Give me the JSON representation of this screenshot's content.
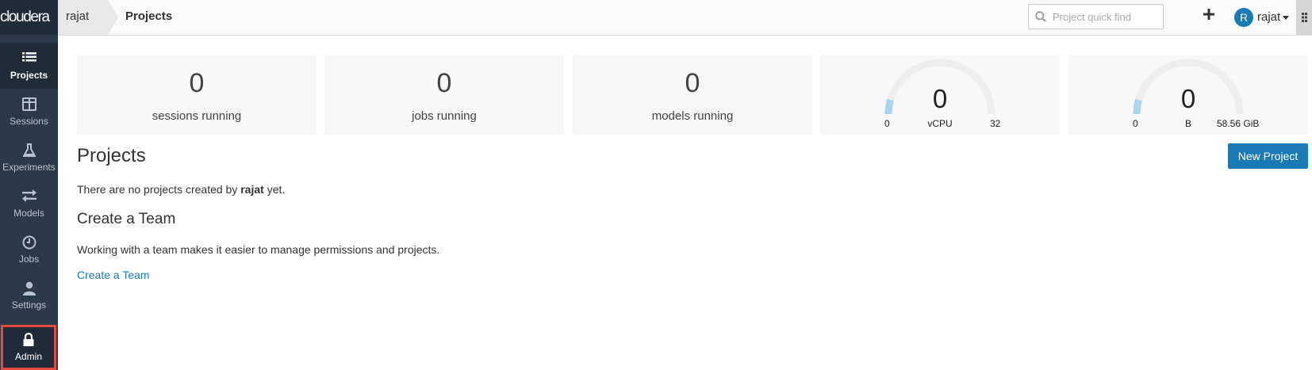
{
  "brand": {
    "logo_text": "cloudera"
  },
  "sidebar": {
    "items": [
      {
        "label": "Projects",
        "icon": "list-icon",
        "active": true
      },
      {
        "label": "Sessions",
        "icon": "columns-icon"
      },
      {
        "label": "Experiments",
        "icon": "flask-icon"
      },
      {
        "label": "Models",
        "icon": "arrows-exchange-icon"
      },
      {
        "label": "Jobs",
        "icon": "clock-icon"
      },
      {
        "label": "Settings",
        "icon": "user-icon"
      },
      {
        "label": "Admin",
        "icon": "lock-icon",
        "highlighted": true
      }
    ]
  },
  "header": {
    "breadcrumb_user": "rajat",
    "title": "Projects",
    "search_placeholder": "Project quick find",
    "user": {
      "initial": "R",
      "name": "rajat"
    }
  },
  "stats": {
    "sessions": {
      "value": "0",
      "label": "sessions running"
    },
    "jobs": {
      "value": "0",
      "label": "jobs running"
    },
    "models": {
      "value": "0",
      "label": "models running"
    },
    "cpu": {
      "value": "0",
      "min": "0",
      "unit": "vCPU",
      "max": "32",
      "fraction": 0.0
    },
    "memory": {
      "value": "0",
      "min": "0",
      "unit": "B",
      "max": "58.56 GiB",
      "fraction": 0.0
    }
  },
  "main": {
    "heading": "Projects",
    "new_project_label": "New Project",
    "empty_prefix": "There are no projects created by ",
    "empty_user": "rajat",
    "empty_suffix": " yet.",
    "team_heading": "Create a Team",
    "team_text": "Working with a team makes it easier to manage permissions and projects.",
    "team_link": "Create a Team"
  },
  "colors": {
    "sidebar_bg": "#2b3a4a",
    "accent": "#1a7ab5",
    "highlight_border": "#e3493f",
    "gauge_fill": "#a9d6ee"
  }
}
